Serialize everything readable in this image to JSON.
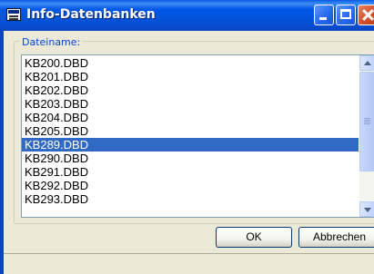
{
  "window": {
    "title": "Info-Datenbanken",
    "controls": [
      "minimize",
      "maximize",
      "close"
    ]
  },
  "group": {
    "label": "Dateiname:"
  },
  "files": {
    "items": [
      "KB200.DBD",
      "KB201.DBD",
      "KB202.DBD",
      "KB203.DBD",
      "KB204.DBD",
      "KB205.DBD",
      "KB289.DBD",
      "KB290.DBD",
      "KB291.DBD",
      "KB292.DBD",
      "KB293.DBD"
    ],
    "selected": "KB289.DBD"
  },
  "buttons": {
    "ok": "OK",
    "cancel": "Abbrechen"
  },
  "colors": {
    "selection": "#316ac5",
    "titlebar": "#0058e6",
    "group_label": "#0046d5"
  }
}
